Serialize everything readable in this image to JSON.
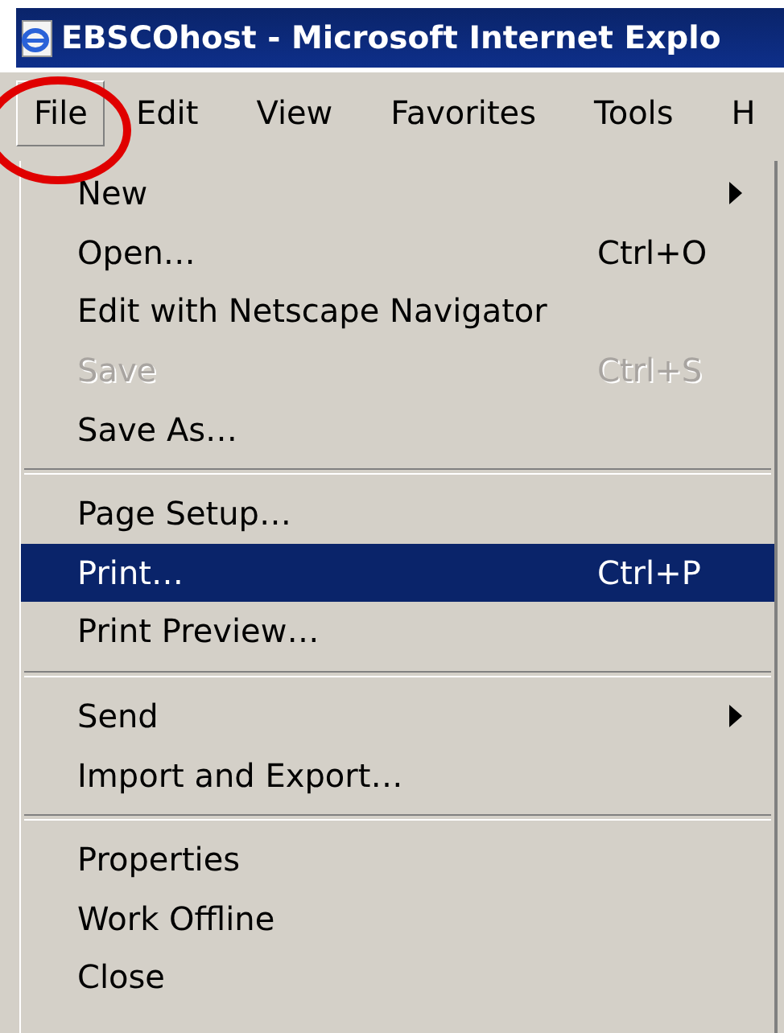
{
  "window": {
    "title": "EBSCOhost - Microsoft Internet Explo"
  },
  "menu_bar": [
    {
      "label": "File",
      "selected": true
    },
    {
      "label": "Edit",
      "selected": false
    },
    {
      "label": "View",
      "selected": false
    },
    {
      "label": "Favorites",
      "selected": false
    },
    {
      "label": "Tools",
      "selected": false
    },
    {
      "label": "H",
      "selected": false
    }
  ],
  "file_menu": [
    [
      {
        "label": "New",
        "submenu": true,
        "disabled": false,
        "selected": false
      },
      {
        "label": "Open…",
        "shortcut": "Ctrl+O",
        "submenu": false,
        "disabled": false,
        "selected": false
      },
      {
        "label": "Edit with Netscape Navigator",
        "submenu": false,
        "disabled": false,
        "selected": false
      },
      {
        "label": "Save",
        "shortcut": "Ctrl+S",
        "submenu": false,
        "disabled": true,
        "selected": false
      },
      {
        "label": "Save As…",
        "submenu": false,
        "disabled": false,
        "selected": false
      }
    ],
    [
      {
        "label": "Page Setup…",
        "submenu": false,
        "disabled": false,
        "selected": false
      },
      {
        "label": "Print…",
        "shortcut": "Ctrl+P",
        "submenu": false,
        "disabled": false,
        "selected": true
      },
      {
        "label": "Print Preview…",
        "submenu": false,
        "disabled": false,
        "selected": false
      }
    ],
    [
      {
        "label": "Send",
        "submenu": true,
        "disabled": false,
        "selected": false
      },
      {
        "label": "Import and Export…",
        "submenu": false,
        "disabled": false,
        "selected": false
      }
    ],
    [
      {
        "label": "Properties",
        "submenu": false,
        "disabled": false,
        "selected": false
      },
      {
        "label": "Work Offline",
        "submenu": false,
        "disabled": false,
        "selected": false
      },
      {
        "label": "Close",
        "submenu": false,
        "disabled": false,
        "selected": false
      }
    ]
  ]
}
